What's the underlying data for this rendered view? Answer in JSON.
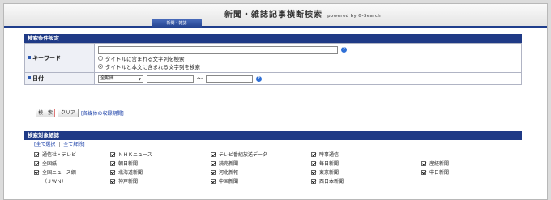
{
  "header": {
    "title": "新聞・雑誌記事横断検索",
    "subtitle": "powered by G-Search",
    "tab_label": "新聞・雑誌"
  },
  "search_section": {
    "heading": "検索条件設定",
    "keyword": {
      "label": "キーワード",
      "value": "",
      "options": [
        {
          "label": "タイトルに含まれる文字列を検索",
          "selected": false
        },
        {
          "label": "タイトルと本文に含まれる文字列を検索",
          "selected": true
        }
      ]
    },
    "date": {
      "label": "日付",
      "period": "全期間",
      "from": "",
      "separator": "〜",
      "to": ""
    },
    "buttons": {
      "search": "検　索",
      "clear": "クリア",
      "coverage_link": "[各媒体の収録期間]"
    }
  },
  "sources_section": {
    "heading": "検索対象紙誌",
    "select_all": "[全て選択",
    "separator": "|",
    "deselect_all": "全て解除]",
    "rows": [
      [
        "通信社・テレビ",
        "ＮＨＫニュース",
        "テレビ番組放送データ",
        "時事通信",
        ""
      ],
      [
        "全国紙",
        "朝日新聞",
        "読売新聞",
        "毎日新聞",
        "産経新聞"
      ],
      [
        "全国ニュース網",
        "北海道新聞",
        "河北新報",
        "東京新聞",
        "中日新聞"
      ],
      [
        "（ＪＷＮ）",
        "神戸新聞",
        "中国新聞",
        "西日本新聞",
        ""
      ]
    ],
    "checked": [
      [
        true,
        true,
        true,
        true,
        false
      ],
      [
        true,
        true,
        true,
        true,
        true
      ],
      [
        true,
        true,
        true,
        true,
        true
      ],
      [
        false,
        true,
        true,
        true,
        false
      ]
    ]
  },
  "colors": {
    "accent": "#1f3a86",
    "link": "#1a3fa8",
    "help": "#2e6fd6"
  }
}
